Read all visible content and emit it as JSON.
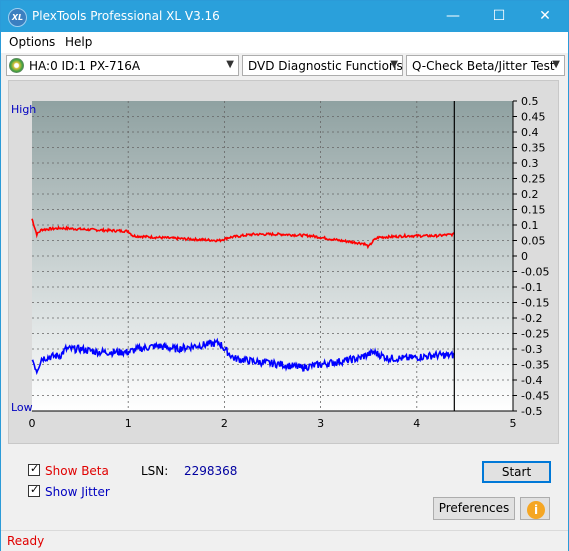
{
  "window": {
    "title": "PlexTools Professional XL V3.16",
    "minimize": "—",
    "maximize": "☐",
    "close": "✕"
  },
  "menu": {
    "options": "Options",
    "help": "Help"
  },
  "toolbar": {
    "drive": "HA:0 ID:1  PX-716A",
    "function": "DVD Diagnostic Functions",
    "test": "Q-Check Beta/Jitter Test"
  },
  "chart": {
    "label_high": "High",
    "label_low": "Low"
  },
  "chart_data": {
    "type": "line",
    "x_ticks": [
      "0",
      "1",
      "2",
      "3",
      "4",
      "5"
    ],
    "x_range": [
      0,
      5
    ],
    "y_right_ticks": [
      "0.5",
      "0.45",
      "0.4",
      "0.35",
      "0.3",
      "0.25",
      "0.2",
      "0.15",
      "0.1",
      "0.05",
      "0",
      "-0.05",
      "-0.1",
      "-0.15",
      "-0.2",
      "-0.25",
      "-0.3",
      "-0.35",
      "-0.4",
      "-0.45",
      "-0.5"
    ],
    "y_range": [
      -0.5,
      0.5
    ],
    "end_marker_x": 4.39,
    "series": [
      {
        "color": "#ff0000",
        "points": [
          [
            0.0,
            0.12
          ],
          [
            0.05,
            0.07
          ],
          [
            0.1,
            0.085
          ],
          [
            0.3,
            0.09
          ],
          [
            0.6,
            0.085
          ],
          [
            1.0,
            0.08
          ],
          [
            1.05,
            0.065
          ],
          [
            1.3,
            0.06
          ],
          [
            1.6,
            0.055
          ],
          [
            1.95,
            0.05
          ],
          [
            2.05,
            0.06
          ],
          [
            2.3,
            0.07
          ],
          [
            2.6,
            0.07
          ],
          [
            2.9,
            0.065
          ],
          [
            3.2,
            0.05
          ],
          [
            3.45,
            0.04
          ],
          [
            3.5,
            0.03
          ],
          [
            3.55,
            0.05
          ],
          [
            3.6,
            0.06
          ],
          [
            3.9,
            0.065
          ],
          [
            4.2,
            0.065
          ],
          [
            4.39,
            0.07
          ]
        ]
      },
      {
        "color": "#0000ff",
        "points": [
          [
            0.0,
            -0.33
          ],
          [
            0.05,
            -0.37
          ],
          [
            0.1,
            -0.33
          ],
          [
            0.3,
            -0.32
          ],
          [
            0.35,
            -0.3
          ],
          [
            0.5,
            -0.3
          ],
          [
            0.7,
            -0.31
          ],
          [
            1.0,
            -0.31
          ],
          [
            1.1,
            -0.3
          ],
          [
            1.3,
            -0.29
          ],
          [
            1.5,
            -0.3
          ],
          [
            1.7,
            -0.29
          ],
          [
            1.95,
            -0.28
          ],
          [
            2.0,
            -0.3
          ],
          [
            2.1,
            -0.33
          ],
          [
            2.3,
            -0.34
          ],
          [
            2.6,
            -0.35
          ],
          [
            2.8,
            -0.36
          ],
          [
            3.0,
            -0.35
          ],
          [
            3.2,
            -0.34
          ],
          [
            3.4,
            -0.33
          ],
          [
            3.55,
            -0.31
          ],
          [
            3.7,
            -0.33
          ],
          [
            3.9,
            -0.33
          ],
          [
            4.2,
            -0.32
          ],
          [
            4.39,
            -0.32
          ]
        ]
      }
    ]
  },
  "controls": {
    "show_beta": "Show Beta",
    "show_jitter": "Show Jitter",
    "lsn_label": "LSN:",
    "lsn_value": "2298368",
    "start": "Start",
    "preferences": "Preferences",
    "info": "i"
  },
  "status": {
    "text": "Ready"
  }
}
